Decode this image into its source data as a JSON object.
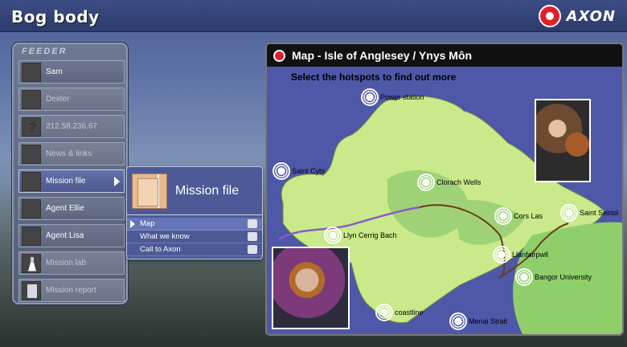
{
  "header": {
    "title": "Bog body",
    "brand": "AXON"
  },
  "feeder": {
    "title": "FEEDER",
    "items": [
      {
        "label": "Sam",
        "icon": "avatar-sam"
      },
      {
        "label": "Dexter",
        "icon": "avatar-dexter"
      },
      {
        "label": "212.58.236.67",
        "icon": "question-icon"
      },
      {
        "label": "News & links",
        "icon": "news-icon"
      },
      {
        "label": "Mission file",
        "icon": "folder-icon"
      },
      {
        "label": "Agent Ellie",
        "icon": "avatar-ellie"
      },
      {
        "label": "Agent Lisa",
        "icon": "avatar-lisa"
      },
      {
        "label": "Mission lab",
        "icon": "flask-icon"
      },
      {
        "label": "Mission report",
        "icon": "clipboard-icon"
      }
    ]
  },
  "mission": {
    "title": "Mission file",
    "items": [
      {
        "label": "Map"
      },
      {
        "label": "What we know"
      },
      {
        "label": "Call to Axon"
      }
    ]
  },
  "map": {
    "title": "Map - Isle of Anglesey / Ynys Môn",
    "instruction": "Select the hotspots to find out more",
    "hotspots": [
      {
        "label": "Power station"
      },
      {
        "label": "Saint Cybi"
      },
      {
        "label": "Clorach Wells"
      },
      {
        "label": "Cors Las"
      },
      {
        "label": "Saint Seiriol"
      },
      {
        "label": "Llyn Cerrig Bach"
      },
      {
        "label": "Llanfairpwll"
      },
      {
        "label": "Bangor University"
      },
      {
        "label": "coastline"
      },
      {
        "label": "Menai Strait"
      }
    ]
  },
  "colors": {
    "accent": "#e11f28",
    "panel": "#4d5a97",
    "sea": "#4e57a8",
    "land": "#c9e98a"
  }
}
